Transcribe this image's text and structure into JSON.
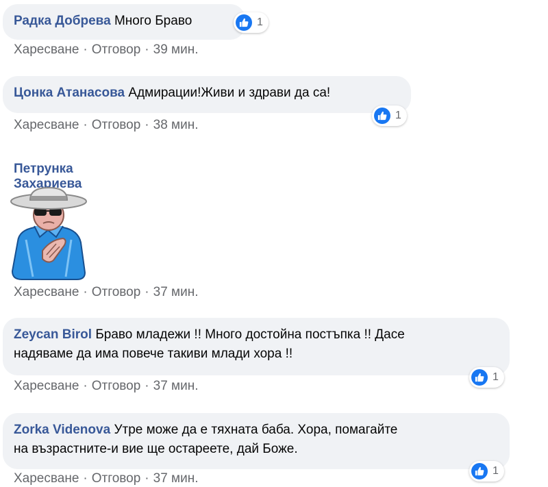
{
  "comments": [
    {
      "author": "Радка Добрева",
      "text": "Много Браво",
      "reaction_count": "1",
      "like_label": "Харесване",
      "reply_label": "Отговор",
      "time": "39 мин."
    },
    {
      "author": "Цонка Атанасова",
      "text": "Адмирации!Живи и здрави да са!",
      "reaction_count": "1",
      "like_label": "Харесване",
      "reply_label": "Отговор",
      "time": "38 мин."
    },
    {
      "author": "Петрунка Захариева",
      "sticker": "man-with-hat-and-sunglasses-clapping-sticker",
      "like_label": "Харесване",
      "reply_label": "Отговор",
      "time": "37 мин."
    },
    {
      "author": "Zeycan Birol",
      "text_line1": "Браво младежи !! Много достойна постъпка !! Дасе",
      "text_line2": "надяваме да има повече такиви млади хора !!",
      "reaction_count": "1",
      "like_label": "Харесване",
      "reply_label": "Отговор",
      "time": "37 мин."
    },
    {
      "author": "Zorka Videnova",
      "text_line1": "Утре може да е тяхната баба. Хора, помагайте",
      "text_line2": "на възрастните-и вие ще остареете, дай Боже.",
      "reaction_count": "1",
      "like_label": "Харесване",
      "reply_label": "Отговор",
      "time": "37 мин."
    }
  ],
  "separator": "·",
  "colors": {
    "author": "#385898",
    "bubble": "#f0f2f5",
    "meta": "#65676b",
    "like_blue": "#1877f2"
  },
  "icons": {
    "reaction": "like-thumbs-up-icon"
  }
}
